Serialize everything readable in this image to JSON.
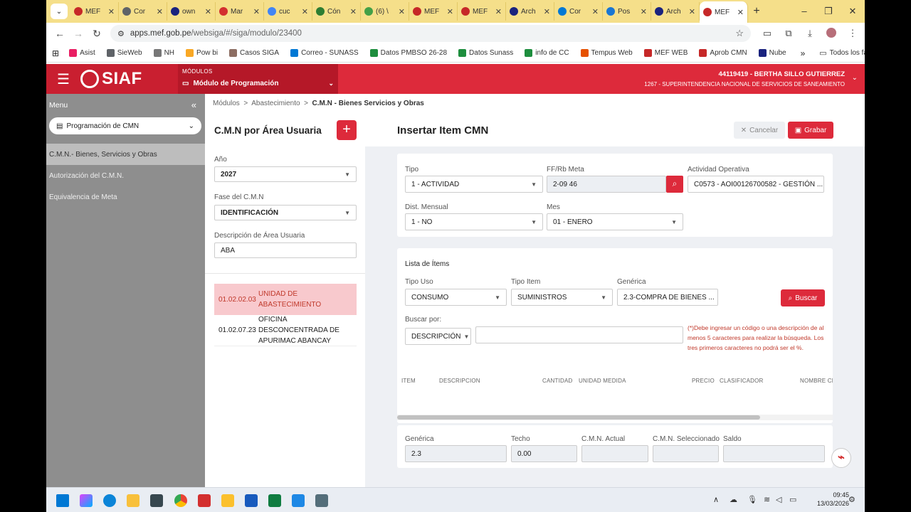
{
  "browser": {
    "tabs": [
      {
        "label": "MEF",
        "color": "#c62828"
      },
      {
        "label": "Cor",
        "color": "#5f6368"
      },
      {
        "label": "own",
        "color": "#1a237e"
      },
      {
        "label": "Mar",
        "color": "#d32f2f"
      },
      {
        "label": "cuc",
        "color": "#4285f4"
      },
      {
        "label": "Cón",
        "color": "#2e7d32"
      },
      {
        "label": "(6) \\",
        "color": "#43a047"
      },
      {
        "label": "MEF",
        "color": "#c62828"
      },
      {
        "label": "MEF",
        "color": "#c62828"
      },
      {
        "label": "Arch",
        "color": "#1a237e"
      },
      {
        "label": "Cor",
        "color": "#0078d4"
      },
      {
        "label": "Pos",
        "color": "#1976d2"
      },
      {
        "label": "Arch",
        "color": "#1a237e"
      },
      {
        "label": "MEF",
        "color": "#c62828",
        "active": true
      }
    ],
    "url_host": "apps.mef.gob.pe",
    "url_path": "/websiga/#/siga/modulo/23400",
    "bookmarks": [
      {
        "label": "Asist",
        "color": "#e91e63"
      },
      {
        "label": "SieWeb",
        "color": "#5f6368"
      },
      {
        "label": "NH",
        "color": "#777"
      },
      {
        "label": "Pow bi",
        "color": "#f9a825"
      },
      {
        "label": "Casos SIGA",
        "color": "#8d6e63"
      },
      {
        "label": "Correo - SUNASS",
        "color": "#0078d4"
      },
      {
        "label": "Datos PMBSO 26-28",
        "color": "#1e8e3e"
      },
      {
        "label": "Datos Sunass",
        "color": "#1e8e3e"
      },
      {
        "label": "info de CC",
        "color": "#1e8e3e"
      },
      {
        "label": "Tempus Web",
        "color": "#e65100"
      },
      {
        "label": "MEF WEB",
        "color": "#c62828"
      },
      {
        "label": "Aprob CMN",
        "color": "#c62828"
      },
      {
        "label": "Nube",
        "color": "#1a237e"
      }
    ],
    "bookmarks_more": "»",
    "all_bookmarks": "Todos los favoritos"
  },
  "header": {
    "logo": "SIAF",
    "modules_label": "MÓDULOS",
    "module_name": "Módulo de Programación",
    "user_line1": "44119419 - BERTHA SILLO GUTIERREZ",
    "user_line2": "1267 - SUPERINTENDENCIA NACIONAL DE SERVICIOS DE SANEAMIENTO"
  },
  "sidebar": {
    "title": "Menu",
    "selector": "Programación de CMN",
    "items": [
      {
        "label": "C.M.N.- Bienes, Servicios y Obras"
      },
      {
        "label": "Autorización del C.M.N."
      },
      {
        "label": "Equivalencia de Meta"
      }
    ]
  },
  "breadcrumb": {
    "b1": "Módulos",
    "b2": "Abastecimiento",
    "b3": "C.M.N - Bienes Servicios y Obras"
  },
  "left_panel": {
    "title": "C.M.N por Área Usuaria",
    "anio_label": "Año",
    "anio": "2027",
    "fase_label": "Fase del C.M.N",
    "fase": "IDENTIFICACIÓN",
    "desc_label": "Descripción de Área Usuaria",
    "desc": "ABA",
    "rows": [
      {
        "code": "01.02.02.03",
        "name": "UNIDAD DE ABASTECIMIENTO"
      },
      {
        "code": "01.02.07.23",
        "name": "OFICINA DESCONCENTRADA DE APURIMAC ABANCAY"
      }
    ]
  },
  "main": {
    "title": "Insertar Item CMN",
    "cancel": "Cancelar",
    "save": "Grabar",
    "tipo_label": "Tipo",
    "tipo": "1 - ACTIVIDAD",
    "ff_label": "FF/Rb Meta",
    "ff": "2-09  46",
    "act_label": "Actividad Operativa",
    "act": "C0573 - AOI00126700582 - GESTIÓN ...",
    "dist_label": "Dist. Mensual",
    "dist": "1 - NO",
    "mes_label": "Mes",
    "mes": "01 - ENERO",
    "lista_title": "Lista de Ítems",
    "tipouso_label": "Tipo Uso",
    "tipouso": "CONSUMO",
    "tipoitem_label": "Tipo Item",
    "tipoitem": "SUMINISTROS",
    "generica_label": "Genérica",
    "generica": "2.3-COMPRA DE BIENES ...",
    "buscar": "Buscar",
    "buscarpor_label": "Buscar por:",
    "buscarpor": "DESCRIPCIÓN",
    "search_value": "",
    "note": "(*)Debe ingresar un código o una descripción de al menos 5 caracteres para realizar la búsqueda. Los tres primeros caracteres no podrá ser el %.",
    "columns": [
      "ITEM",
      "DESCRIPCION",
      "CANTIDAD",
      "UNIDAD MEDIDA",
      "PRECIO",
      "CLASIFICADOR",
      "NOMBRE CLA"
    ],
    "sum_generica_label": "Genérica",
    "sum_generica": "2.3",
    "techo_label": "Techo",
    "techo": "0.00",
    "cmn_actual_label": "C.M.N. Actual",
    "cmn_actual": "",
    "cmn_sel_label": "C.M.N. Seleccionado",
    "cmn_sel": "",
    "saldo_label": "Saldo",
    "saldo": ""
  },
  "taskbar": {
    "time": "09:45",
    "date": "13/03/2026"
  }
}
